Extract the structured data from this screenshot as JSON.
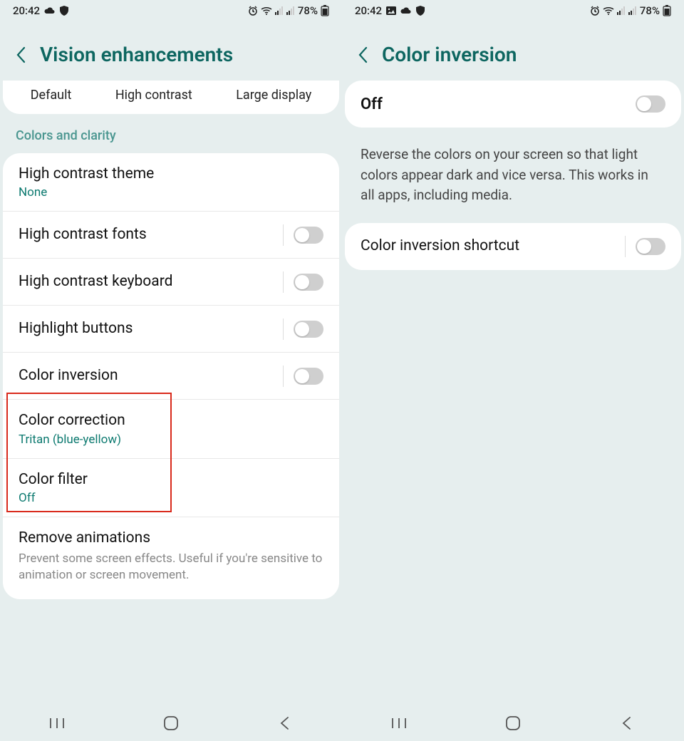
{
  "status": {
    "time": "20:42",
    "battery": "78%"
  },
  "left": {
    "title": "Vision enhancements",
    "tabs": {
      "a": "Default",
      "b": "High contrast",
      "c": "Large display"
    },
    "section": "Colors and clarity",
    "items": {
      "hct": {
        "title": "High contrast theme",
        "sub": "None"
      },
      "hcf": {
        "title": "High contrast fonts"
      },
      "hck": {
        "title": "High contrast keyboard"
      },
      "hlb": {
        "title": "Highlight buttons"
      },
      "cinv": {
        "title": "Color inversion"
      },
      "ccor": {
        "title": "Color correction",
        "sub": "Tritan (blue-yellow)"
      },
      "cfil": {
        "title": "Color filter",
        "sub": "Off"
      },
      "ranim": {
        "title": "Remove animations",
        "desc": "Prevent some screen effects. Useful if you're sensitive to animation or screen movement."
      }
    }
  },
  "right": {
    "title": "Color inversion",
    "state": "Off",
    "desc": "Reverse the colors on your screen so that light colors appear dark and vice versa. This works in all apps, including media.",
    "shortcut": "Color inversion shortcut"
  }
}
